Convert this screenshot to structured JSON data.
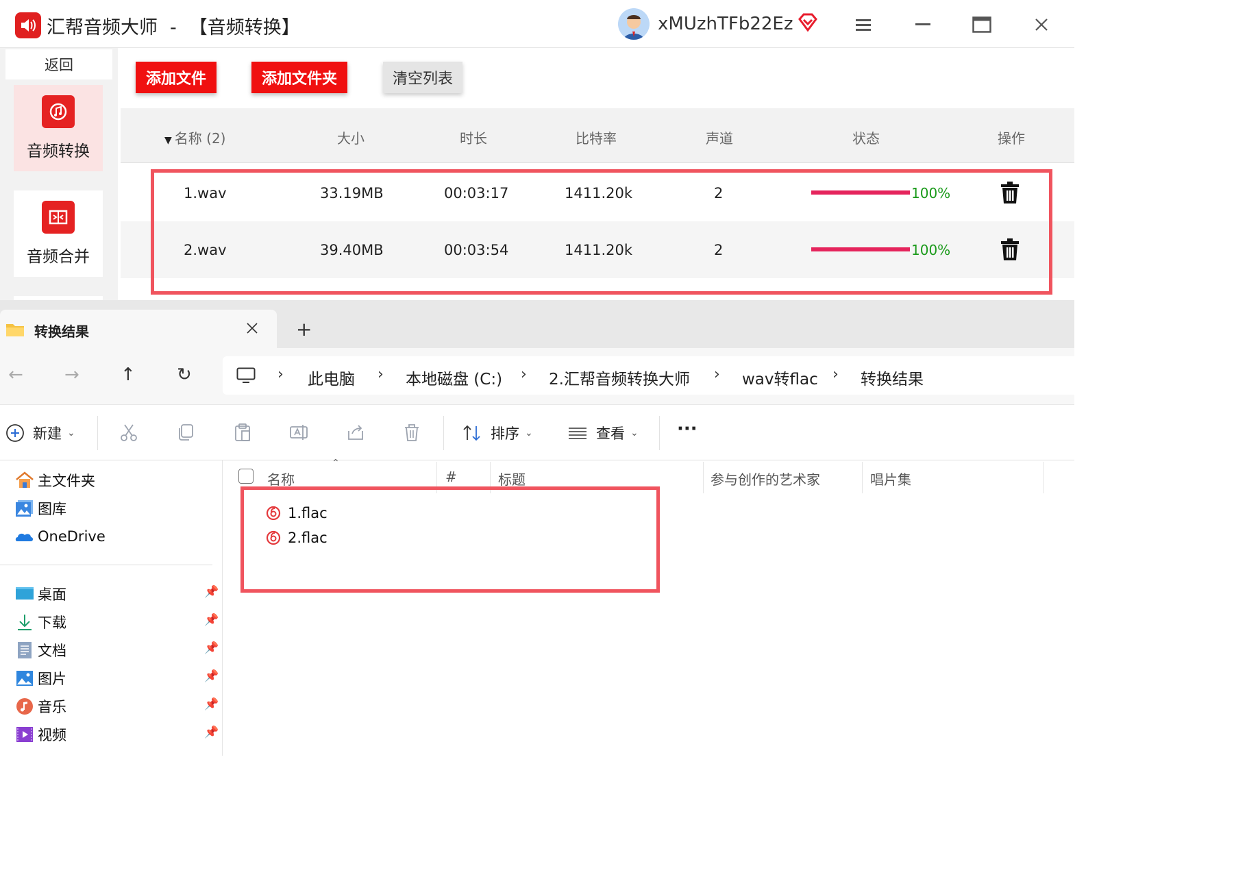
{
  "app": {
    "title_name": "汇帮音频大师",
    "title_sep": "-",
    "title_page": "【音频转换】",
    "username": "xMUzhTFb22Ez",
    "back_label": "返回",
    "sidebar": [
      {
        "label": "音频转换",
        "icon": "audio-convert-icon",
        "active": true
      },
      {
        "label": "音频合并",
        "icon": "audio-merge-icon",
        "active": false
      }
    ],
    "toolbar": {
      "add_file": "添加文件",
      "add_folder": "添加文件夹",
      "clear_list": "清空列表"
    },
    "table": {
      "headers": {
        "name": "名称 (2)",
        "size": "大小",
        "duration": "时长",
        "bitrate": "比特率",
        "channels": "声道",
        "status": "状态",
        "action": "操作"
      },
      "rows": [
        {
          "name": "1.wav",
          "size": "33.19MB",
          "duration": "00:03:17",
          "bitrate": "1411.20k",
          "channels": "2",
          "progress": 1.0,
          "percent": "100%"
        },
        {
          "name": "2.wav",
          "size": "39.40MB",
          "duration": "00:03:54",
          "bitrate": "1411.20k",
          "channels": "2",
          "progress": 1.0,
          "percent": "100%"
        }
      ]
    },
    "colors": {
      "accent": "#f01010",
      "progress": "#e5245c",
      "percent_text": "#1a9a1a",
      "highlight": "#f0545e"
    }
  },
  "explorer": {
    "tab_title": "转换结果",
    "new_tab": "+",
    "breadcrumb": [
      "此电脑",
      "本地磁盘 (C:)",
      "2.汇帮音频转换大师",
      "wav转flac",
      "转换结果"
    ],
    "commands": {
      "new": "新建",
      "sort": "排序",
      "view": "查看",
      "more": "···"
    },
    "nav": {
      "quick": [
        {
          "label": "主文件夹",
          "icon": "home-icon"
        },
        {
          "label": "图库",
          "icon": "gallery-icon"
        },
        {
          "label": "OneDrive",
          "icon": "onedrive-icon"
        }
      ],
      "pinned": [
        {
          "label": "桌面",
          "icon": "desktop-icon"
        },
        {
          "label": "下载",
          "icon": "download-icon"
        },
        {
          "label": "文档",
          "icon": "documents-icon"
        },
        {
          "label": "图片",
          "icon": "pictures-icon"
        },
        {
          "label": "音乐",
          "icon": "music-icon"
        },
        {
          "label": "视频",
          "icon": "videos-icon"
        }
      ]
    },
    "columns": {
      "name": "名称",
      "number": "#",
      "title": "标题",
      "artists": "参与创作的艺术家",
      "album": "唱片集"
    },
    "files": [
      "1.flac",
      "2.flac"
    ]
  }
}
